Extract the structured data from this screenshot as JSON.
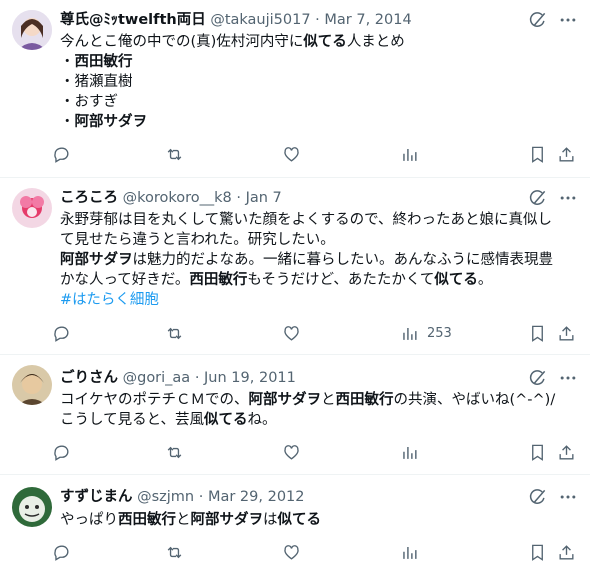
{
  "tweets": [
    {
      "name": "尊氏@ﾐｯtwelfth両日",
      "handle": "@takauji5017",
      "date": "Mar 7, 2014",
      "lines": [
        [
          {
            "t": "今んとこ俺の中での(真)佐村河内守に",
            "b": false
          },
          {
            "t": "似てる",
            "b": true
          },
          {
            "t": "人まとめ",
            "b": false
          }
        ],
        [
          {
            "t": "・",
            "b": false
          },
          {
            "t": "西田敏行",
            "b": true
          }
        ],
        [
          {
            "t": "・猪瀬直樹",
            "b": false
          }
        ],
        [
          {
            "t": "・おすぎ",
            "b": false
          }
        ],
        [
          {
            "t": "・",
            "b": false
          },
          {
            "t": "阿部サダヲ",
            "b": true
          }
        ]
      ],
      "views": ""
    },
    {
      "name": "ころころ",
      "handle": "@korokoro__k8",
      "date": "Jan 7",
      "lines": [
        [
          {
            "t": "永野芽郁は目を丸くして驚いた顔をよくするので、終わったあと娘に真似し",
            "b": false
          }
        ],
        [
          {
            "t": "て見せたら違うと言われた。研究したい。",
            "b": false
          }
        ],
        [
          {
            "t": "阿部サダヲ",
            "b": true
          },
          {
            "t": "は魅力的だよなあ。一緒に暮らしたい。あんなふうに感情表現豊",
            "b": false
          }
        ],
        [
          {
            "t": "かな人って好きだ。",
            "b": false
          },
          {
            "t": "西田敏行",
            "b": true
          },
          {
            "t": "もそうだけど、あたたかくて",
            "b": false
          },
          {
            "t": "似てる",
            "b": true
          },
          {
            "t": "。",
            "b": false
          }
        ],
        [
          {
            "t": "#はたらく細胞",
            "b": false,
            "h": true
          }
        ]
      ],
      "views": "253"
    },
    {
      "name": "ごりさん",
      "handle": "@gori_aa",
      "date": "Jun 19, 2011",
      "lines": [
        [
          {
            "t": "コイケヤのポテチＣＭでの、",
            "b": false
          },
          {
            "t": "阿部サダヲ",
            "b": true
          },
          {
            "t": "と",
            "b": false
          },
          {
            "t": "西田敏行",
            "b": true
          },
          {
            "t": "の共演、やばいね(^-^)/",
            "b": false
          }
        ],
        [
          {
            "t": "こうして見ると、芸風",
            "b": false
          },
          {
            "t": "似てる",
            "b": true
          },
          {
            "t": "ね。",
            "b": false
          }
        ]
      ],
      "views": ""
    },
    {
      "name": "すずじまん",
      "handle": "@szjmn",
      "date": "Mar 29, 2012",
      "lines": [
        [
          {
            "t": "やっぱり",
            "b": false
          },
          {
            "t": "西田敏行",
            "b": true
          },
          {
            "t": "と",
            "b": false
          },
          {
            "t": "阿部サダヲ",
            "b": true
          },
          {
            "t": "は",
            "b": false
          },
          {
            "t": "似てる",
            "b": true
          }
        ]
      ],
      "views": ""
    }
  ],
  "separator": "·",
  "icons": {
    "reply": "reply-icon",
    "repost": "repost-icon",
    "like": "like-icon",
    "views": "views-icon",
    "bookmark": "bookmark-icon",
    "share": "share-icon",
    "grok": "grok-icon",
    "more": "more-icon"
  },
  "colors": {
    "text": "#0f1419",
    "meta": "#536471",
    "link": "#1d9bf0",
    "divider": "#eff3f4"
  }
}
